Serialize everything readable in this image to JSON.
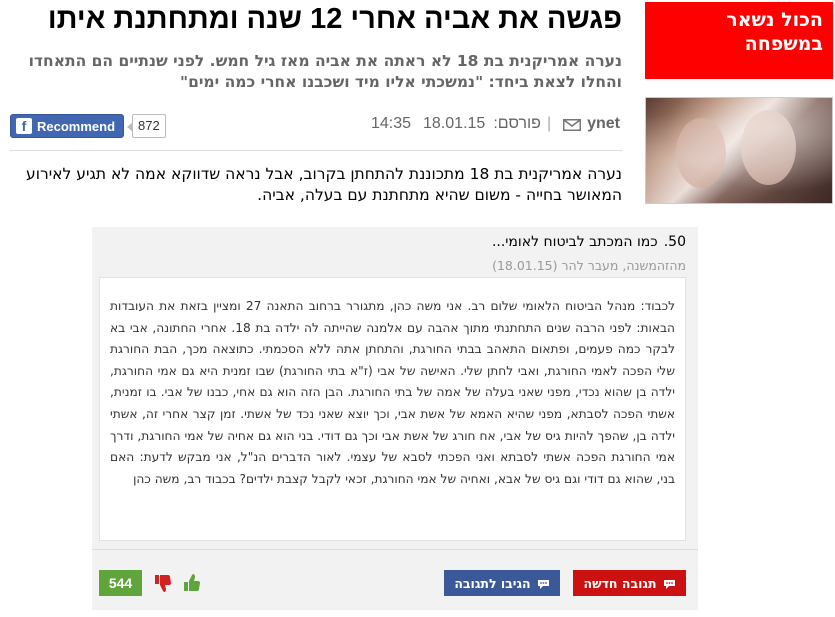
{
  "sidebar": {
    "promo_title": "הכול נשאר במשפחה"
  },
  "article": {
    "headline": "פגשה את אביה אחרי 12 שנה ומתחתנת איתו",
    "subhead": "נערה אמריקנית בת 18 לא ראתה את אביה מאז גיל חמש. לפני שנתיים הם התאחדו והחלו לצאת ביחד: \"נמשכתי אליו מיד ושכבנו אחרי כמה ימים\"",
    "source": "ynet",
    "published_label": "פורסם:",
    "date": "18.01.15",
    "time": "14:35",
    "lead": "נערה אמריקנית בת 18 מתכוננת להתחתן בקרוב, אבל נראה שדווקא אמה לא תגיע לאירוע המאושר בחייה - משום שהיא מתחתנת עם בעלה, אביה."
  },
  "facebook": {
    "recommend_label": "Recommend",
    "count": "872"
  },
  "comment": {
    "number": "50.",
    "title": "כמו המכתב לביטוח לאומי...",
    "meta": "מהזהמשנה, מעבר להר (18.01.15)",
    "body": "לכבוד: מנהל הביטוח הלאומי שלום רב. אני משה כהן, מתגורר ברחוב התאנה 27 ומציין בזאת את העובדות הבאות: לפני הרבה שנים התחתנתי מתוך אהבה עם אלמנה שהייתה לה ילדה בת 18. אחרי החתונה, אבי בא לבקר כמה פעמים, ופתאום התאהב בבתי החורגת, והתחתן אתה ללא הסכמתי. כתוצאה מכך, הבת החורגת שלי הפכה לאמי החורגת, ואבי לחתן שלי. האישה של אבי (ז\"א בתי החורגת) שבו זמנית היא גם אמי החורגת, ילדה בן שהוא נכדי, מפני שאני בעלה של אמה של בתי החורגת. הבן הזה הוא גם אחי, כבנו של אבי. בו זמנית, אשתי הפכה לסבתא, מפני שהיא האמא של אשת אבי, וכך יוצא שאני נכד של אשתי. זמן קצר אחרי זה, אשתי ילדה בן, שהפך להיות גיס של אבי, אח חורג של אשת אבי וכך גם דודי. בני הוא גם אחיה של אמי החורגת, ודרך אמי החורגת הפכה אשתי לסבתא ואני הפכתי לסבא של עצמי. לאור הדברים הנ\"ל, אני מבקש לדעת: האם בני, שהוא גם דודי וגם גיס של אבא, ואחיה של אמי החורגת, זכאי לקבל קצבת ילדים? בכבוד רב, משה כהן",
    "votes_up": "544",
    "reply_label": "הגיבו לתגובה",
    "new_label": "תגובה חדשה"
  },
  "colors": {
    "promo_red": "#ff0000",
    "facebook_blue": "#4267b2",
    "reply_blue": "#3b5998",
    "new_red": "#cc1111",
    "vote_green": "#5fa53b"
  }
}
